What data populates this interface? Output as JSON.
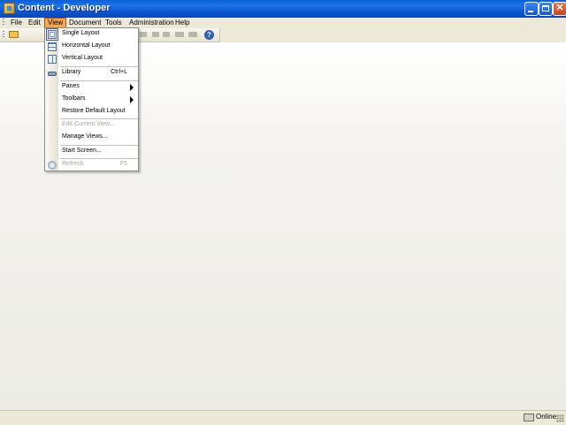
{
  "window": {
    "title": "Content - Developer"
  },
  "menubar": {
    "items": [
      "File",
      "Edit",
      "View",
      "Document",
      "Tools",
      "Administration",
      "Help"
    ]
  },
  "view_menu": {
    "items": [
      {
        "label": "Single Layout",
        "icon": "single-layout-icon"
      },
      {
        "label": "Horizontal Layout",
        "icon": "horizontal-layout-icon"
      },
      {
        "label": "Vertical Layout",
        "icon": "vertical-layout-icon"
      },
      {
        "label": "Library",
        "shortcut": "Ctrl+L",
        "icon": "library-icon"
      },
      {
        "label": "Panes",
        "submenu": true
      },
      {
        "label": "Toolbars",
        "submenu": true
      },
      {
        "label": "Restore Default Layout"
      },
      {
        "label": "Edit Current View...",
        "disabled": true
      },
      {
        "label": "Manage Views..."
      },
      {
        "label": "Start Screen..."
      },
      {
        "label": "Refresh",
        "shortcut": "F5",
        "disabled": true,
        "icon": "refresh-icon"
      }
    ]
  },
  "statusbar": {
    "status": "Online"
  },
  "colors": {
    "titlebar": "#0a5fd8",
    "menu_highlight": "#f7a94a",
    "chrome": "#ece9d8"
  }
}
